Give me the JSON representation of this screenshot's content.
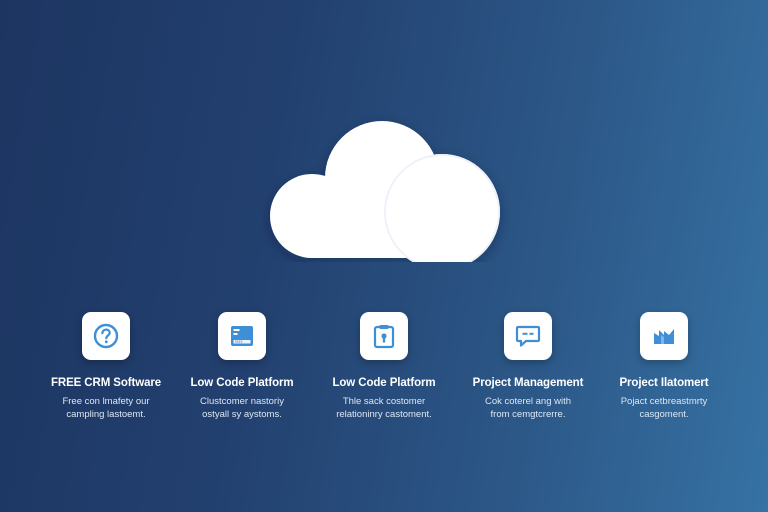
{
  "theme": {
    "background_start": "#1d3561",
    "background_end": "#3672a4",
    "icon_accent": "#3f8fd6",
    "tile_background": "#ffffff"
  },
  "hero": {
    "icon": "cloud-icon"
  },
  "features": [
    {
      "icon": "help-circle-icon",
      "title": "FREE CRM Software",
      "description": "Free con lmafety our\ncampling lastoemt."
    },
    {
      "icon": "spreadsheet-icon",
      "title": "Low Code Platform",
      "description": "Clustcomer nastoriy\nostyall sy aystoms."
    },
    {
      "icon": "clipboard-lock-icon",
      "title": "Low Code Platform",
      "description": "Thle sack costomer\nrelationinry castoment."
    },
    {
      "icon": "chat-bubble-icon",
      "title": "Project Management",
      "description": "Cok coterel ang with\nfrom cemgtcrerre."
    },
    {
      "icon": "bar-chart-icon",
      "title": "Project Ilatomert",
      "description": "Pojact cetbreastmrty\ncasgoment."
    }
  ]
}
